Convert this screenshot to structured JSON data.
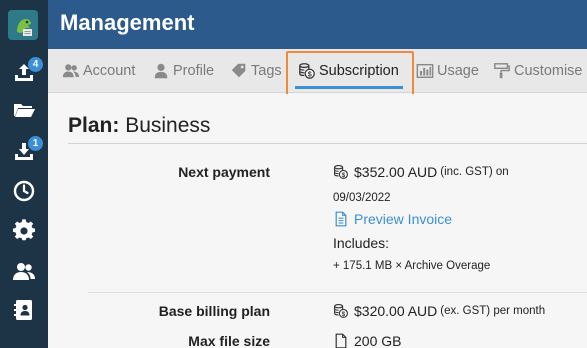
{
  "header": {
    "title": "Management"
  },
  "rail": {
    "badges": {
      "upload": "4",
      "download": "1"
    }
  },
  "tabs": [
    {
      "label": "Account"
    },
    {
      "label": "Profile"
    },
    {
      "label": "Tags"
    },
    {
      "label": "Subscription",
      "active": true
    },
    {
      "label": "Usage"
    },
    {
      "label": "Customise"
    }
  ],
  "plan": {
    "label": "Plan:",
    "name": "Business"
  },
  "next_payment": {
    "label": "Next payment",
    "amount": "$352.00 AUD",
    "tax_note": "(inc. GST) on",
    "date": "09/03/2022",
    "preview_link": "Preview Invoice",
    "includes_label": "Includes:",
    "includes_item": "+ 175.1 MB × Archive Overage"
  },
  "base_billing": {
    "label": "Base billing plan",
    "amount": "$320.00 AUD",
    "tax_note": "(ex. GST) per month"
  },
  "max_file_size": {
    "label": "Max file size",
    "value": "200 GB"
  },
  "colors": {
    "accent": "#3b8fd3",
    "header": "#2c5a8c",
    "rail": "#1d3346",
    "highlight": "#ef8a3a"
  }
}
